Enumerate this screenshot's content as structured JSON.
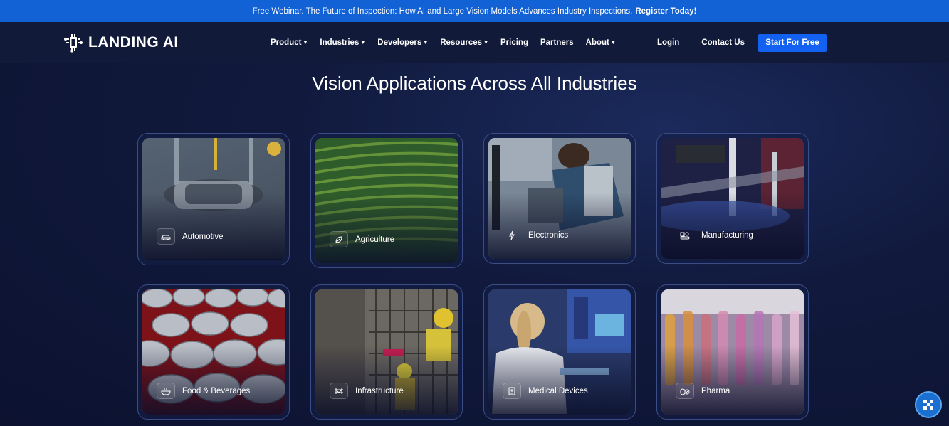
{
  "banner": {
    "text": "Free Webinar. The Future of Inspection: How AI and Large Vision Models Advances Industry Inspections.",
    "link": "Register Today!"
  },
  "header": {
    "logo_text": "LANDING AI",
    "menu": [
      {
        "label": "Product",
        "icon": "chevron-down-icon"
      },
      {
        "label": "Industries",
        "icon": "chevron-down-icon"
      },
      {
        "label": "Developers",
        "icon": "chevron-down-icon"
      },
      {
        "label": "Resources",
        "icon": "chevron-down-icon"
      },
      {
        "label": "Pricing"
      },
      {
        "label": "Partners"
      },
      {
        "label": "About",
        "icon": "chevron-down-icon"
      }
    ],
    "login": "Login",
    "contact": "Contact Us",
    "cta": "Start For Free",
    "cta_color": "#1261f0"
  },
  "main": {
    "title": "Vision Applications Across All Industries",
    "cards": [
      {
        "label": "Automotive",
        "icon": "car-icon"
      },
      {
        "label": "Agriculture",
        "icon": "leaf-icon"
      },
      {
        "label": "Electronics",
        "icon": "lightning-icon"
      },
      {
        "label": "Manufacturing",
        "icon": "factory-icon"
      },
      {
        "label": "Food & Beverages",
        "icon": "bowl-icon"
      },
      {
        "label": "Infrastructure",
        "icon": "bridge-icon"
      },
      {
        "label": "Medical Devices",
        "icon": "medical-device-icon"
      },
      {
        "label": "Pharma",
        "icon": "pills-icon"
      }
    ]
  },
  "colors": {
    "banner": "#1262d6",
    "nav_bg": "#121a3a",
    "page_bg": "#111a3d",
    "card_border": "#3b4d86"
  }
}
